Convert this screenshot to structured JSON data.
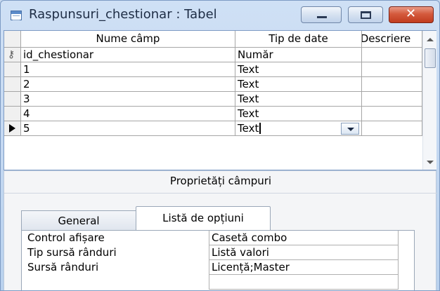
{
  "window": {
    "title": "Raspunsuri_chestionar : Tabel",
    "minimize_icon": "minimize-icon",
    "maximize_icon": "maximize-icon",
    "close_icon": "close-icon",
    "close_glyph": "✕"
  },
  "grid": {
    "columns": [
      "Nume câmp",
      "Tip de date",
      "Descriere"
    ],
    "rows": [
      {
        "name": "id_chestionar",
        "type": "Număr",
        "description": "",
        "primary_key": true
      },
      {
        "name": "1",
        "type": "Text",
        "description": ""
      },
      {
        "name": "2",
        "type": "Text",
        "description": ""
      },
      {
        "name": "3",
        "type": "Text",
        "description": ""
      },
      {
        "name": "4",
        "type": "Text",
        "description": ""
      },
      {
        "name": "5",
        "type": "Text",
        "description": "",
        "current": true
      }
    ]
  },
  "properties": {
    "title": "Proprietăți câmpuri",
    "tabs": [
      "General",
      "Listă de opțiuni"
    ],
    "active_tab": "Listă de opțiuni",
    "rows": [
      {
        "label": "Control afișare",
        "value": "Casetă combo"
      },
      {
        "label": "Tip sursă rânduri",
        "value": "Listă valori"
      },
      {
        "label": "Sursă rânduri",
        "value": "Licență;Master"
      },
      {
        "label": "",
        "value": ""
      }
    ]
  }
}
